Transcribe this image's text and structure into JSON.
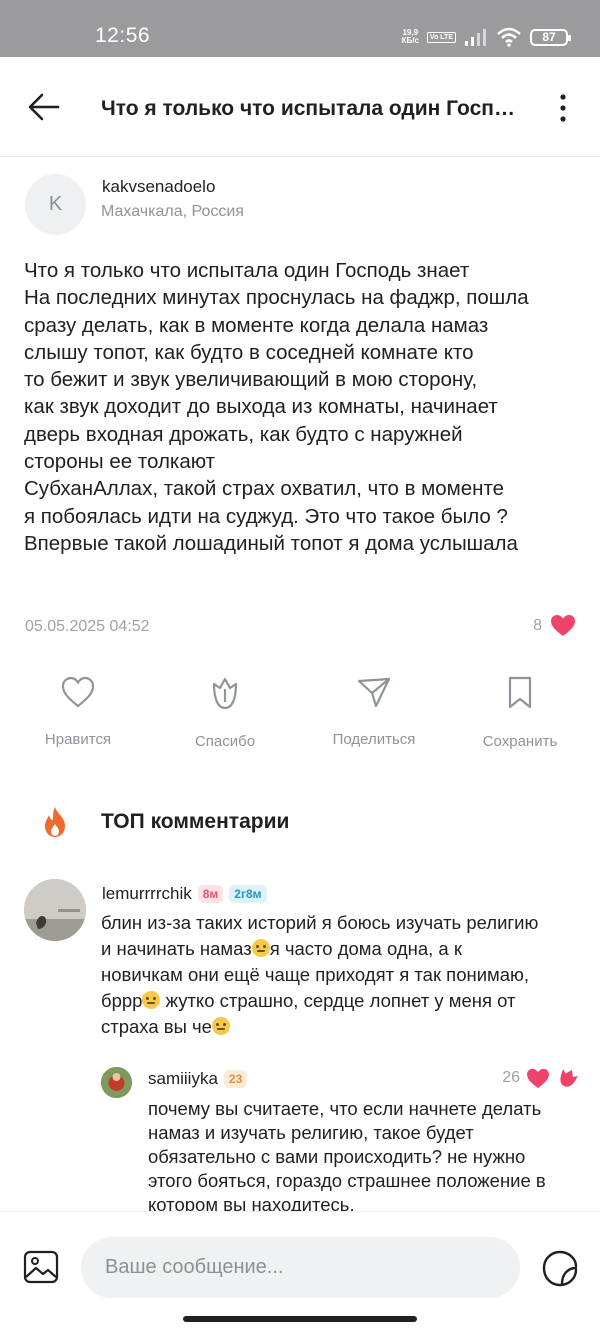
{
  "status_bar": {
    "time": "12:56",
    "net_speed_value": "19,9",
    "net_speed_unit": "КБ/с",
    "volte": "Vo LTE",
    "battery": "87"
  },
  "header": {
    "title": "Что я только что испытала один Господь знает"
  },
  "post": {
    "author_initial": "K",
    "author_name": "kakvsenadoelo",
    "author_location": "Махачкала, Россия",
    "text_lines": [
      "Что я только что испытала один Господь знает",
      "На последних минутах проснулась на фаджр, пошла",
      "сразу делать, как в моменте когда делала намаз",
      "слышу топот, как будто в соседней комнате кто",
      "то бежит и звук увеличивающий в мою сторону,",
      "как звук доходит до выхода из комнаты, начинает",
      "дверь входная дрожать, как будто с наружней",
      "стороны ее толкают",
      "СубханАллах, такой страх охватил, что в моменте",
      "я побоялась идти на суджуд. Это что такое было ?",
      "Впервые такой лошадиный топот я дома услышала"
    ],
    "date": "05.05.2025 04:52",
    "like_count": "8"
  },
  "actions": {
    "like": "Нравится",
    "thanks": "Спасибо",
    "share": "Поделиться",
    "save": "Сохранить"
  },
  "top_comments": {
    "title": "ТОП комментарии",
    "comment": {
      "author": "lemurrrrchik",
      "badge1": "8м",
      "badge2": "2г8м",
      "line1": "блин из-за таких историй я боюсь изучать религию",
      "line2a": "и начинать намаз",
      "line2b": "я часто дома одна, а к",
      "line3": "новичкам они ещё чаще приходят я так понимаю,",
      "line4a": "бррр",
      "line4b": " жутко страшно, сердце лопнет у меня от",
      "line5": "страха вы че"
    },
    "reply": {
      "author": "samiiiyka",
      "badge": "23",
      "like_count": "26",
      "lines": [
        "почему вы считаете, что если начнете  делать",
        "намаз и изучать религию, такое будет",
        "обязательно с вами происходить? не нужно",
        "этого бояться, гораздо страшнее положение в",
        "котором вы находитесь."
      ]
    }
  },
  "composer": {
    "placeholder": "Ваше сообщение..."
  },
  "colors": {
    "heart": "#f0436b",
    "fire": "#f26a2e",
    "text": "#1f2024",
    "muted": "#8f939a"
  }
}
